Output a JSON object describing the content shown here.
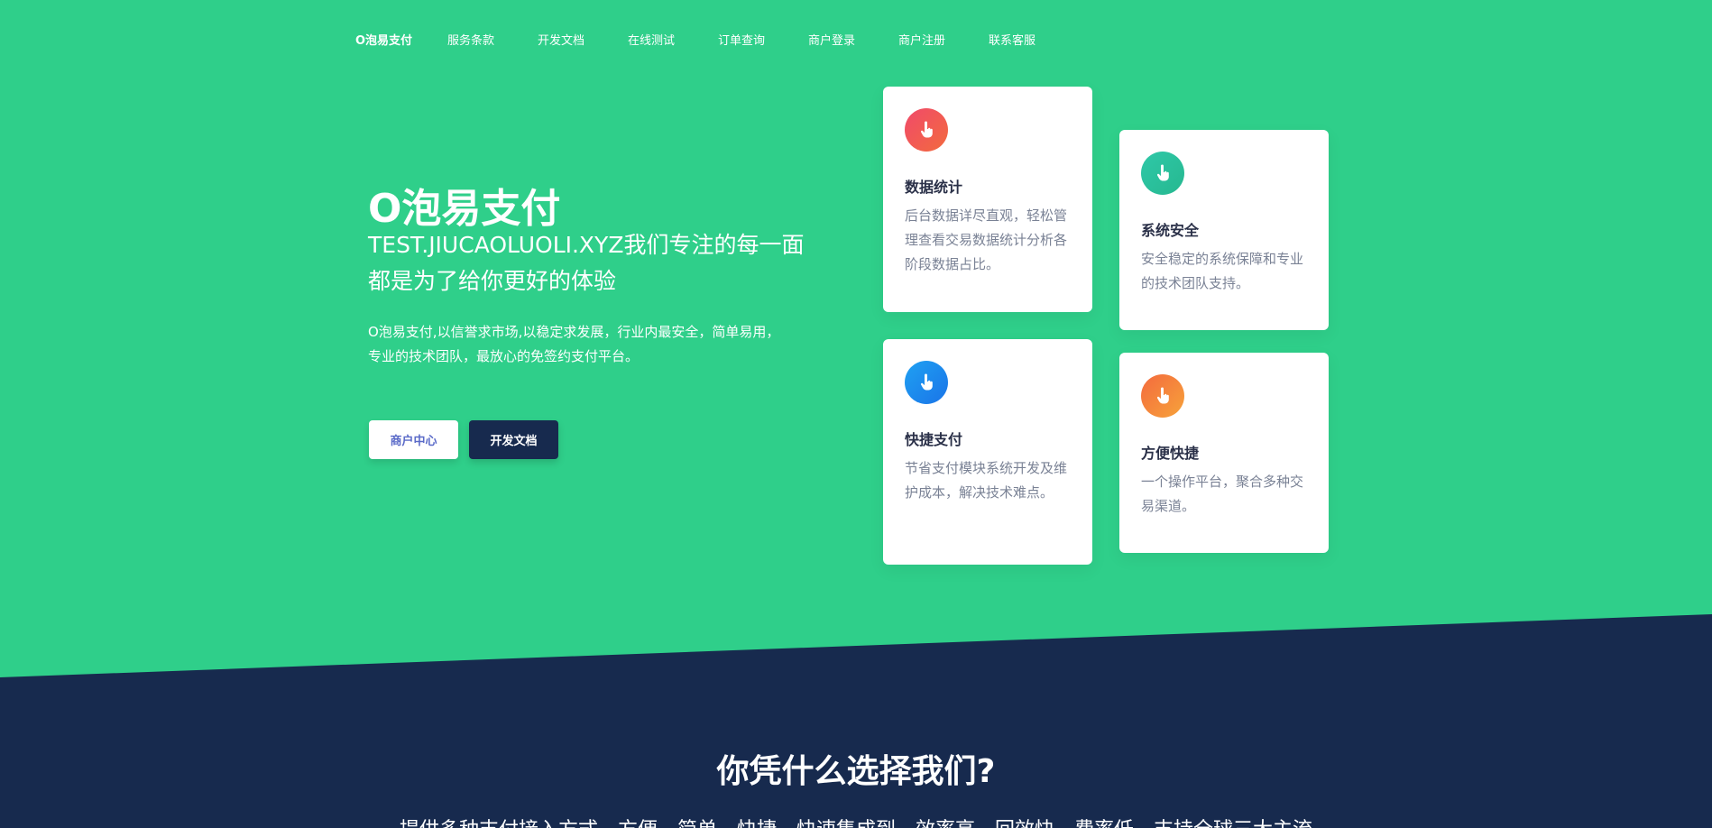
{
  "nav": {
    "brand": "O泡易支付",
    "items": [
      {
        "label": "服务条款"
      },
      {
        "label": "开发文档"
      },
      {
        "label": "在线测试"
      },
      {
        "label": "订单查询"
      },
      {
        "label": "商户登录"
      },
      {
        "label": "商户注册"
      },
      {
        "label": "联系客服"
      }
    ]
  },
  "hero": {
    "title": "O泡易支付",
    "subtitle": "TEST.JIUCAOLUOLI.XYZ我们专注的每一面都是为了给你更好的体验",
    "description": "O泡易支付,以信誉求市场,以稳定求发展，行业内最安全，简单易用，专业的技术团队，最放心的免签约支付平台。",
    "primary_button": "商户中心",
    "secondary_button": "开发文档"
  },
  "features": [
    {
      "title": "数据统计",
      "text": "后台数据详尽直观，轻松管理查看交易数据统计分析各阶段数据占比。",
      "icon": "hand-pointer-icon"
    },
    {
      "title": "系统安全",
      "text": "安全稳定的系统保障和专业的技术团队支持。",
      "icon": "hand-pointer-icon"
    },
    {
      "title": "快捷支付",
      "text": "节省支付模块系统开发及维护成本，解决技术难点。",
      "icon": "hand-pointer-icon"
    },
    {
      "title": "方便快捷",
      "text": "一个操作平台，聚合多种交易渠道。",
      "icon": "hand-pointer-icon"
    }
  ],
  "why": {
    "title": "你凭什么选择我们?",
    "text": "提供多种支付接入方式，方便，简单，快捷，快速集成到，效率高，回效快，费率低，支持全球三大主流"
  },
  "colors": {
    "primary_green": "#2fcf8a",
    "dark_navy": "#172a4e",
    "white": "#ffffff"
  }
}
